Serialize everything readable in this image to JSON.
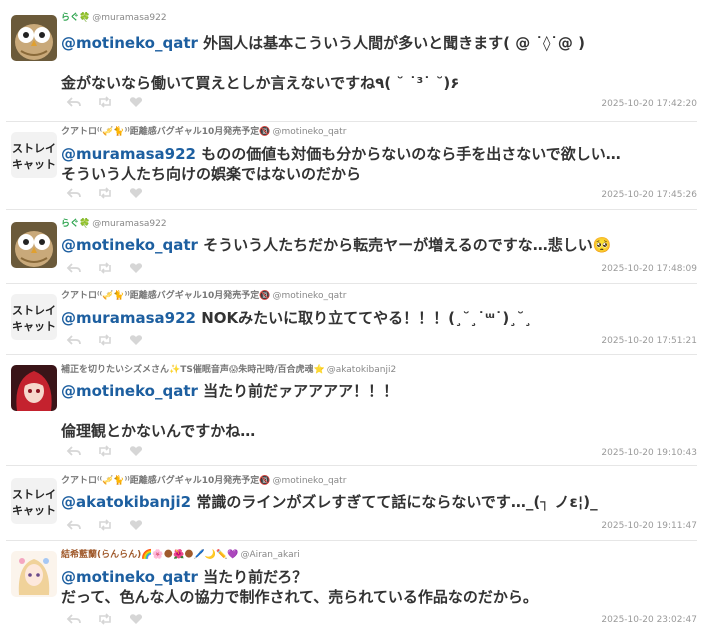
{
  "colors": {
    "mention": "#1d5fa0",
    "name_green": "#2ea44f",
    "name_gray": "#777777",
    "name_red": "#b8402a",
    "name_brown": "#a05a2c",
    "timestamp": "#9a9a9a",
    "separator": "#e6e6e6"
  },
  "tweets": [
    {
      "avatar": "owl-avatar",
      "display_name": "らぐ🍀",
      "handle": "@muramasa922",
      "mention": "@motineko_qatr",
      "lines": [
        "外国人は基本こういう人間が多いと聞きます( @ ˙◊˙@ )",
        "金がないなら働いて買えとしか言えないですね٩( ˘ ˙³˙ ˘)۶"
      ],
      "timestamp": "2025-10-20 17:42:20"
    },
    {
      "avatar": "logo-avatar",
      "display_name": "クアトロ⁽⁽🎺🐈⁾⁾距離感バグギャル10月発売予定🔞",
      "handle": "@motineko_qatr",
      "mention": "@muramasa922",
      "lines": [
        "ものの価値も対価も分からないのなら手を出さないで欲しい…",
        "そういう人たち向けの娯楽ではないのだから"
      ],
      "timestamp": "2025-10-20 17:45:26"
    },
    {
      "avatar": "owl-avatar",
      "display_name": "らぐ🍀",
      "handle": "@muramasa922",
      "mention": "@motineko_qatr",
      "lines": [
        "そういう人たちだから転売ヤーが増えるのですな…悲しい🥺"
      ],
      "timestamp": "2025-10-20 17:48:09"
    },
    {
      "avatar": "logo-avatar",
      "display_name": "クアトロ⁽⁽🎺🐈⁾⁾距離感バグギャル10月発売予定🔞",
      "handle": "@motineko_qatr",
      "mention": "@muramasa922",
      "lines": [
        "NOKみたいに取り立ててやる！！！(¸˘¸˙ᵚ˙)¸˘¸"
      ],
      "timestamp": "2025-10-20 17:51:21"
    },
    {
      "avatar": "redhair-avatar",
      "display_name": "補正を切りたいシズメさん✨TS催眠音声😱朱時卍時/百合虎魂⭐",
      "handle": "@akatokibanji2",
      "mention": "@motineko_qatr",
      "lines": [
        "当たり前だァアアアア！！！",
        "倫理観とかないんですかね…"
      ],
      "timestamp": "2025-10-20 19:10:43"
    },
    {
      "avatar": "logo-avatar",
      "display_name": "クアトロ⁽⁽🎺🐈⁾⁾距離感バグギャル10月発売予定🔞",
      "handle": "@motineko_qatr",
      "mention": "@akatokibanji2",
      "lines": [
        "常識のラインがズレすぎてて話にならないです…_(┐ ノε¦)_"
      ],
      "timestamp": "2025-10-20 19:11:47"
    },
    {
      "avatar": "anime-avatar",
      "display_name": "結希藍蘭(らんらん)🌈🌸🌑🌺🌑🖊️🌙✏️💜",
      "handle": "@Airan_akari",
      "mention": "@motineko_qatr",
      "lines": [
        "当たり前だろ？",
        "だって、色んな人の協力で制作されて、売られている作品なのだから。"
      ],
      "timestamp": "2025-10-20 23:02:47"
    }
  ]
}
